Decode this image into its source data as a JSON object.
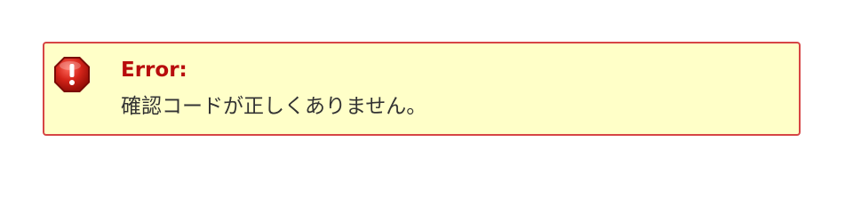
{
  "alert": {
    "type": "error",
    "icon": "error-octagon-icon",
    "title": "Error:",
    "message": "確認コードが正しくありません。",
    "colors": {
      "background": "#ffffc8",
      "border": "#d64545",
      "title": "#b80c0c",
      "icon": "#cc1f1a"
    }
  }
}
